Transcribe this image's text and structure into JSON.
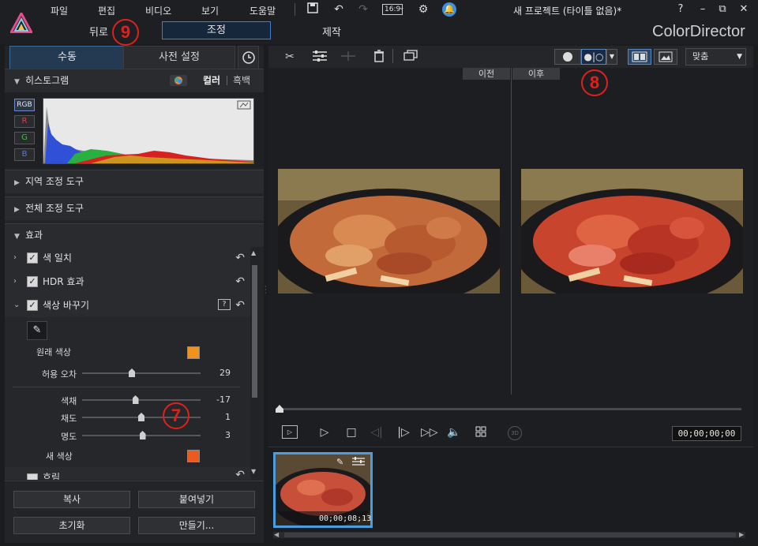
{
  "app": {
    "menu": [
      "파일",
      "편집",
      "비디오",
      "보기",
      "도움말"
    ],
    "aspect_ratio": "16:9",
    "project_title": "새 프로젝트 (타이틀 없음)*",
    "help": "?",
    "brand": "ColorDirector"
  },
  "modes": {
    "back": "뒤로",
    "adjust": "조정",
    "produce": "제작"
  },
  "markers": {
    "m7": "7",
    "m8": "8",
    "m9": "9"
  },
  "left": {
    "tabs": {
      "manual": "수동",
      "preset": "사전 설정"
    },
    "histogram": {
      "title": "히스토그램",
      "color": "컬러",
      "mono": "흑백",
      "channels": [
        "RGB",
        "R",
        "G",
        "B"
      ]
    },
    "sections": {
      "local": "지역 조정 도구",
      "global": "전체 조정 도구",
      "effects": "효과"
    },
    "effects": [
      {
        "label": "색 일치",
        "checked": true
      },
      {
        "label": "HDR 효과",
        "checked": true
      },
      {
        "label": "색상 바꾸기",
        "checked": true
      }
    ],
    "color_replace": {
      "original_color_label": "원래 색상",
      "original_color": "#f0921e",
      "tolerance_label": "허용 오차",
      "tolerance_value": "29",
      "tolerance_pos": 0.42,
      "hue_label": "색채",
      "hue_value": "-17",
      "hue_pos": 0.45,
      "sat_label": "채도",
      "sat_value": "1",
      "sat_pos": 0.5,
      "bright_label": "명도",
      "bright_value": "3",
      "bright_pos": 0.51,
      "new_color_label": "새 색상",
      "new_color": "#ee5a1e"
    },
    "partial_next": "흐림",
    "buttons": {
      "copy": "복사",
      "paste": "붙여넣기",
      "reset": "초기화",
      "create": "만들기..."
    }
  },
  "viewer": {
    "fit": "맞춤",
    "before": "이전",
    "after": "이후",
    "timecode": "00;00;00;00"
  },
  "filmstrip": {
    "clip_time": "00;00;08;13"
  },
  "colors": {
    "accent": "#3f7fd0",
    "marker": "#e0201b",
    "selection": "#4a9ee0"
  }
}
